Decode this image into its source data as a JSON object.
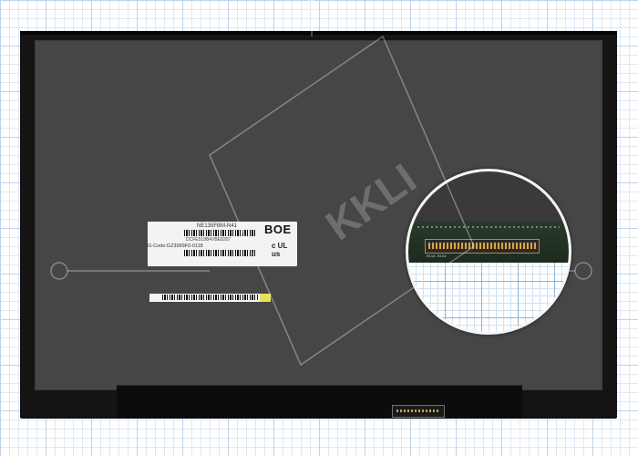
{
  "label": {
    "model": "NE135FBM-N41",
    "serial": "DCFE519B4VBE8207",
    "gcode": "G-Code:GZ3999F0-0118",
    "brand": "BOE",
    "cert_mark": "c UL us"
  },
  "inset": {
    "pcb_text": "R116 R134"
  },
  "watermark": {
    "text": "KKLI"
  },
  "colors": {
    "panel_frame": "#141414",
    "screen_surface": "#464646",
    "grid_major": "#bcd3ea",
    "grid_minor": "#dde9f5",
    "connector_gold": "#c8a24a",
    "label_tag_yellow": "#e9e05a"
  }
}
